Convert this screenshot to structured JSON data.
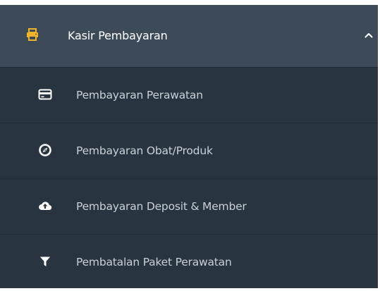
{
  "menu": {
    "header": {
      "label": "Kasir Pembayaran",
      "icon": "printer-icon",
      "expanded": true,
      "icon_color": "#f0b429"
    },
    "items": [
      {
        "label": "Pembayaran Perawatan",
        "icon": "credit-card-icon"
      },
      {
        "label": "Pembayaran Obat/Produk",
        "icon": "compass-icon"
      },
      {
        "label": "Pembayaran Deposit & Member",
        "icon": "cloud-upload-icon"
      },
      {
        "label": "Pembatalan Paket Perawatan",
        "icon": "filter-icon"
      }
    ],
    "colors": {
      "header_bg": "#3d4b58",
      "submenu_bg": "#283440",
      "text": "#ffffff",
      "submenu_text": "#c9d0d7"
    }
  }
}
